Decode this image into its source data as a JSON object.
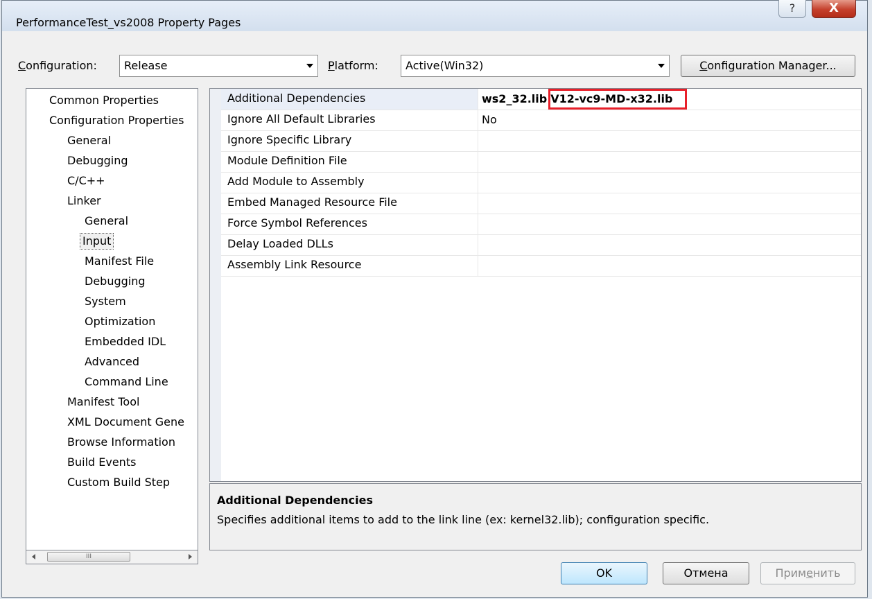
{
  "window": {
    "title": "PerformanceTest_vs2008 Property Pages",
    "help_glyph": "?",
    "close_glyph": "X"
  },
  "toolbar": {
    "configuration_label": "Configuration:",
    "configuration_value": "Release",
    "platform_label": "Platform:",
    "platform_value": "Active(Win32)",
    "config_manager": "Configuration Manager..."
  },
  "tree": {
    "common": "Common Properties",
    "config": "Configuration Properties",
    "general": "General",
    "debugging": "Debugging",
    "cpp": "C/C++",
    "linker": "Linker",
    "linker_items": [
      "General",
      "Input",
      "Manifest File",
      "Debugging",
      "System",
      "Optimization",
      "Embedded IDL",
      "Advanced",
      "Command Line"
    ],
    "manifest_tool": "Manifest Tool",
    "xml_doc": "XML Document Gene",
    "browse": "Browse Information",
    "build_events": "Build Events",
    "custom_build": "Custom Build Step",
    "scroll_glyph": "III"
  },
  "grid": {
    "rows": [
      {
        "name": "Additional Dependencies",
        "value": "ws2_32.lib",
        "value_highlight": "V12-vc9-MD-x32.lib"
      },
      {
        "name": "Ignore All Default Libraries",
        "value": "No"
      },
      {
        "name": "Ignore Specific Library",
        "value": ""
      },
      {
        "name": "Module Definition File",
        "value": ""
      },
      {
        "name": "Add Module to Assembly",
        "value": ""
      },
      {
        "name": "Embed Managed Resource File",
        "value": ""
      },
      {
        "name": "Force Symbol References",
        "value": ""
      },
      {
        "name": "Delay Loaded DLLs",
        "value": ""
      },
      {
        "name": "Assembly Link Resource",
        "value": ""
      }
    ]
  },
  "description": {
    "title": "Additional Dependencies",
    "text": "Specifies additional items to add to the link line (ex: kernel32.lib); configuration specific."
  },
  "buttons": {
    "ok": "OK",
    "cancel": "Отмена",
    "apply": "Применить"
  },
  "colors": {
    "highlight_border": "#e8202a",
    "selected_row": "#e9eef7"
  }
}
